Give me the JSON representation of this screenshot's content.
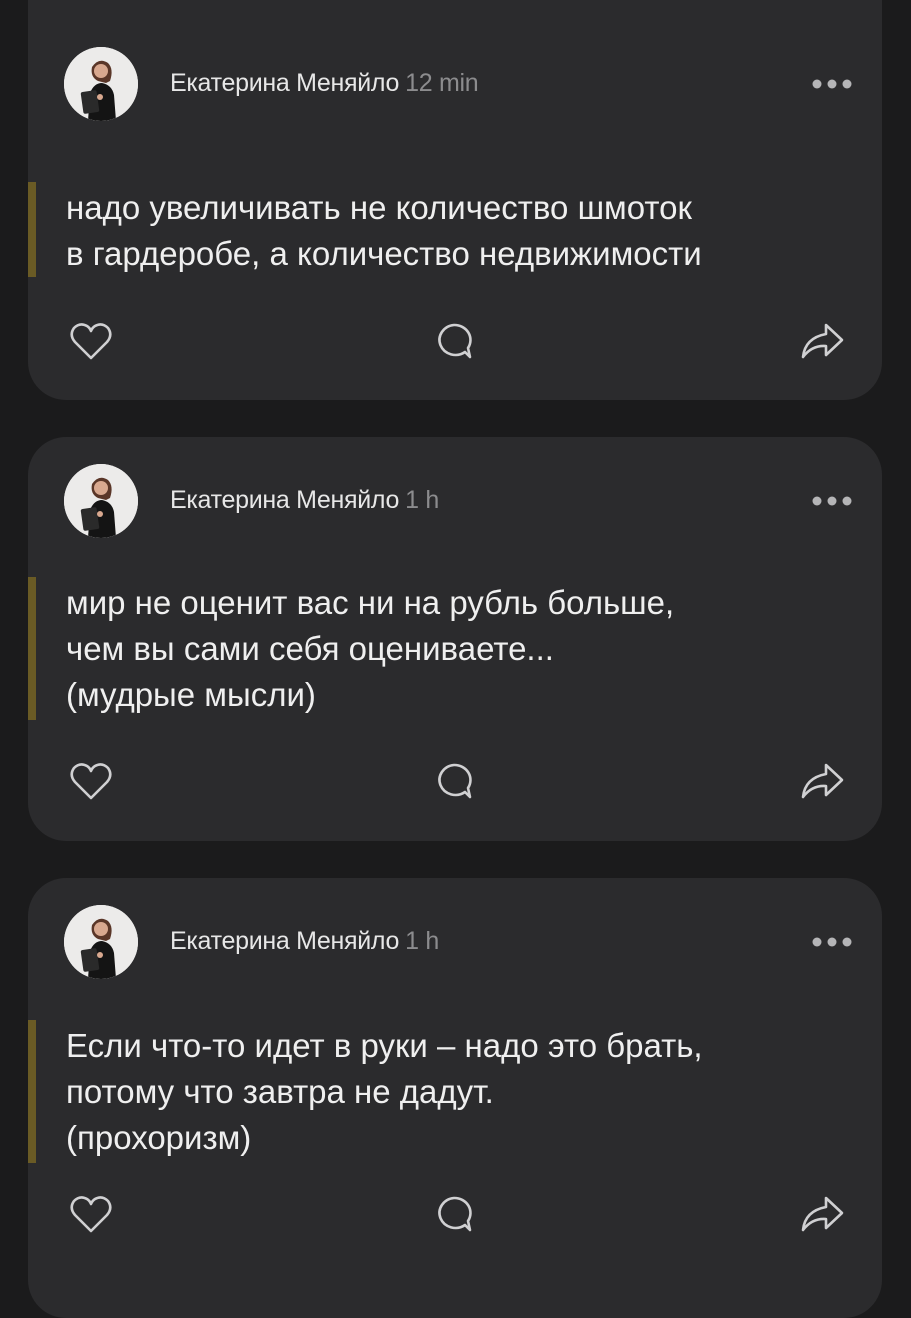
{
  "posts": [
    {
      "author": "Екатерина Меняйло",
      "time": "12 min",
      "text": "надо увеличивать не количество шмоток\nв гардеробе, а количество недвижимости"
    },
    {
      "author": "Екатерина Меняйло",
      "time": "1 h",
      "text": "мир не оценит вас ни на рубль больше,\nчем вы сами себя оцениваете...\n(мудрые мысли)"
    },
    {
      "author": "Екатерина Меняйло",
      "time": "1 h",
      "text": "Если что-то идет в руки – надо это брать,\nпотому что завтра не дадут.\n(прохоризм)"
    }
  ],
  "colors": {
    "background": "#1b1b1c",
    "card": "#2b2b2d",
    "quote_bar": "#6a5b25",
    "text": "#efefef",
    "muted": "#8c8c8e"
  },
  "icons": {
    "like": "heart-icon",
    "comment": "comment-icon",
    "share": "share-icon",
    "more": "more-dots-icon"
  }
}
